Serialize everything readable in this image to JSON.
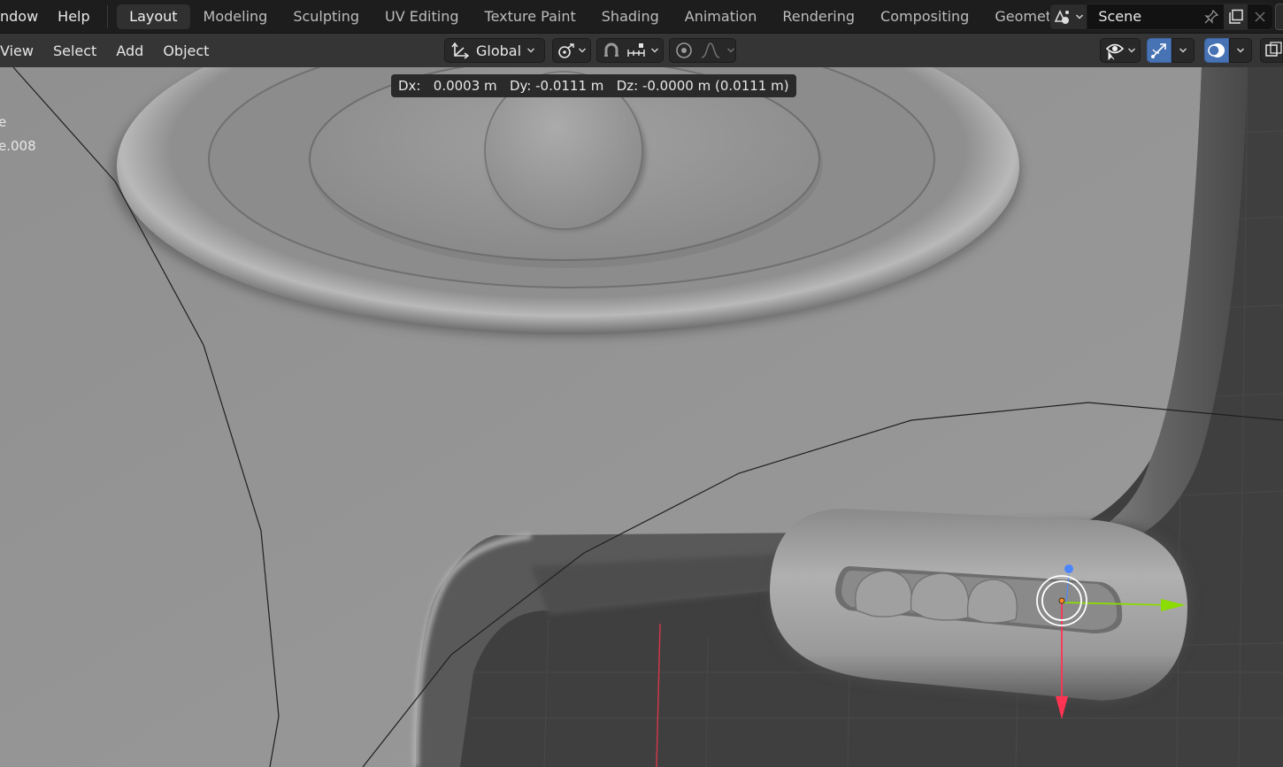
{
  "menu": {
    "window": "ndow",
    "help": "Help"
  },
  "workspaces": [
    {
      "label": "Layout",
      "active": true
    },
    {
      "label": "Modeling",
      "active": false
    },
    {
      "label": "Sculpting",
      "active": false
    },
    {
      "label": "UV Editing",
      "active": false
    },
    {
      "label": "Texture Paint",
      "active": false
    },
    {
      "label": "Shading",
      "active": false
    },
    {
      "label": "Animation",
      "active": false
    },
    {
      "label": "Rendering",
      "active": false
    },
    {
      "label": "Compositing",
      "active": false
    },
    {
      "label": "Geometr",
      "active": false
    }
  ],
  "scene": {
    "name": "Scene"
  },
  "viewport_menu": {
    "view": "View",
    "select": "Select",
    "add": "Add",
    "object": "Object"
  },
  "transform": {
    "orientation": "Global"
  },
  "readout": {
    "text": "Dx:   0.0003 m   Dy: -0.0111 m   Dz: -0.0000 m (0.0111 m)"
  },
  "outliner_fragments": {
    "line1": "e",
    "line2": "e.008"
  },
  "colors": {
    "active_blue": "#4772b3",
    "gizmo_x": "#ff3352",
    "gizmo_y": "#8bdc00",
    "gizmo_z": "#4c86ff",
    "origin": "#ff8a1f"
  }
}
